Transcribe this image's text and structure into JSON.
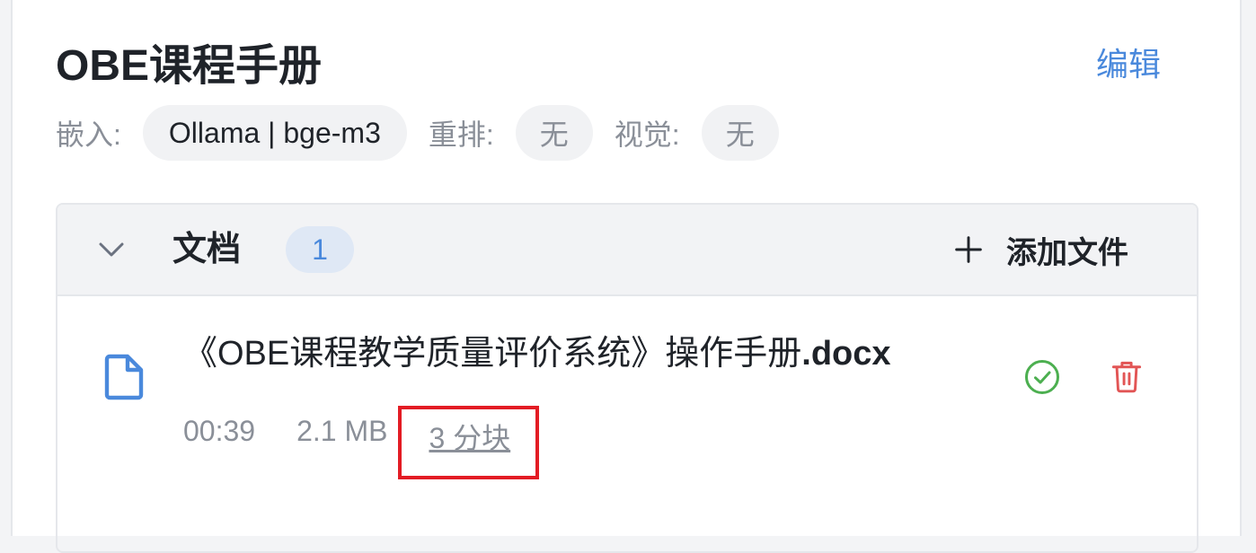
{
  "kb": {
    "title": "OBE课程手册",
    "edit_label": "编辑"
  },
  "meta": {
    "embed_label": "嵌入:",
    "embed_value": "Ollama | bge-m3",
    "rerank_label": "重排:",
    "rerank_value": "无",
    "vision_label": "视觉:",
    "vision_value": "无"
  },
  "documents": {
    "title": "文档",
    "count": "1",
    "add_file_label": "添加文件",
    "files": [
      {
        "name": "《OBE课程教学质量评价系统》操作手册",
        "ext": ".docx",
        "time": "00:39",
        "size": "2.1 MB",
        "chunks": "3 分块"
      }
    ]
  },
  "colors": {
    "accent": "#4a89dc",
    "success": "#4caf50",
    "danger": "#e25555",
    "highlight_box": "#e31c24"
  },
  "icons": {
    "collapse": "chevron-down-icon",
    "add": "plus-icon",
    "file": "document-icon",
    "status": "check-circle-icon",
    "delete": "trash-icon"
  }
}
